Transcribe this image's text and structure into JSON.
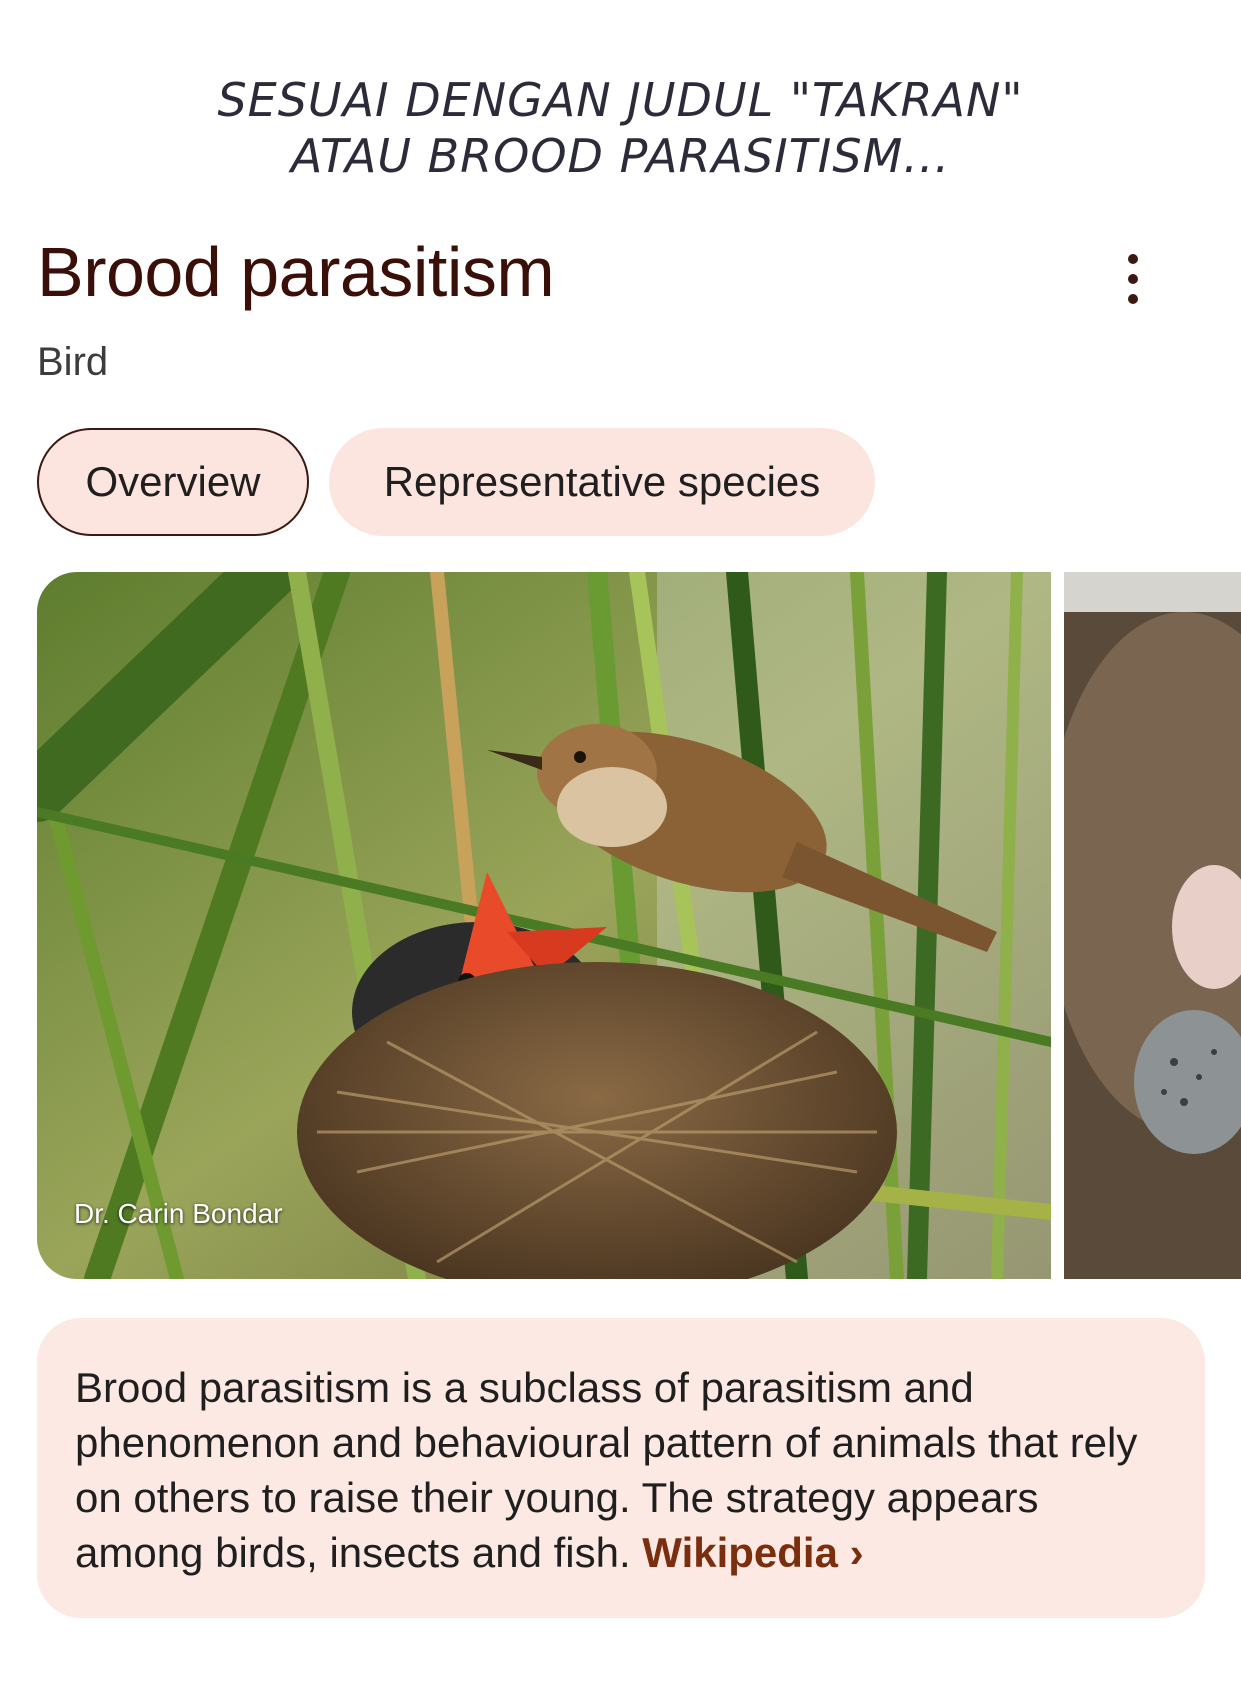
{
  "caption": {
    "line1": "SESUAI DENGAN JUDUL \"TAKRAN\"",
    "line2": "ATAU BROOD PARASITISM..."
  },
  "header": {
    "title": "Brood parasitism",
    "subtitle": "Bird",
    "more_icon": "more-vert-icon"
  },
  "tabs": [
    {
      "label": "Overview",
      "selected": true
    },
    {
      "label": "Representative species",
      "selected": false
    }
  ],
  "images": {
    "main_credit": "Dr. Carin Bondar"
  },
  "description": {
    "text": "Brood parasitism is a subclass of parasitism and phenomenon and behavioural pattern of animals that rely on others to raise their young. The strategy appears among birds, insects and fish.",
    "link_label": "Wikipedia",
    "link_icon": "chevron-right-icon"
  },
  "colors": {
    "chip_bg": "#fde5df",
    "card_bg": "#fde9e3",
    "title": "#3a0f08",
    "link": "#7a2e0e"
  }
}
